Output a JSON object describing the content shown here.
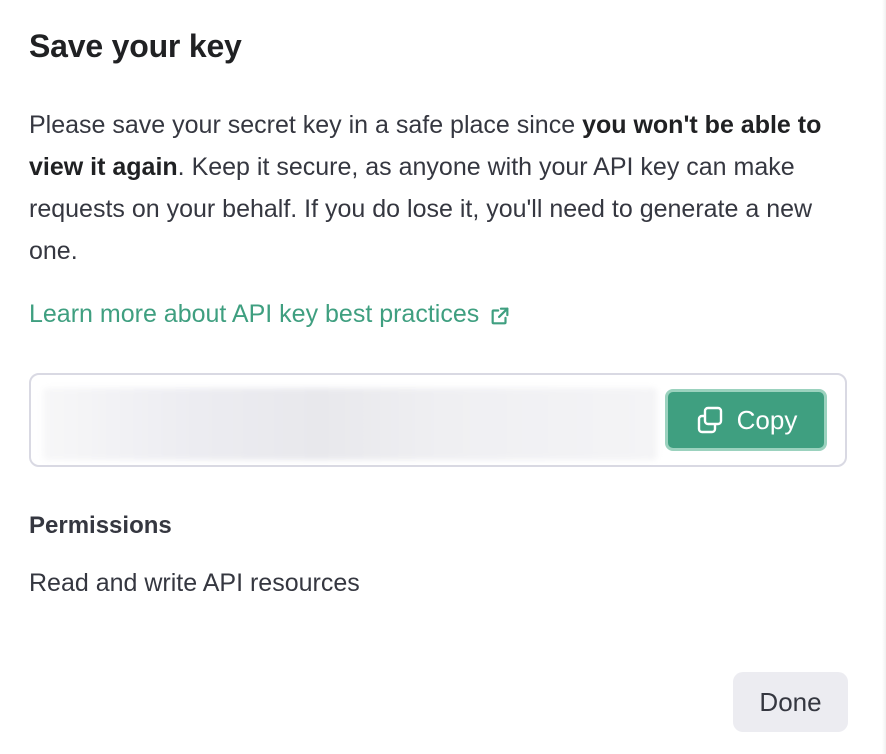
{
  "dialog": {
    "title": "Save your key",
    "description_part1": "Please save your secret key in a safe place since ",
    "description_bold": "you won't be able to view it again",
    "description_part2": ". Keep it secure, as anyone with your API key can make requests on your behalf. If you do lose it, you'll need to generate a new one.",
    "learn_link": "Learn more about API key best practices",
    "copy_label": "Copy",
    "permissions_heading": "Permissions",
    "permissions_value": "Read and write API resources",
    "done_label": "Done"
  },
  "icons": {
    "external_link": "external-link-icon",
    "copy": "copy-icon"
  },
  "colors": {
    "accent": "#3f9f80",
    "accent_border": "#9bd2be",
    "secondary_button_bg": "#ececf1",
    "border": "#d9d9e3",
    "text": "#353740"
  }
}
